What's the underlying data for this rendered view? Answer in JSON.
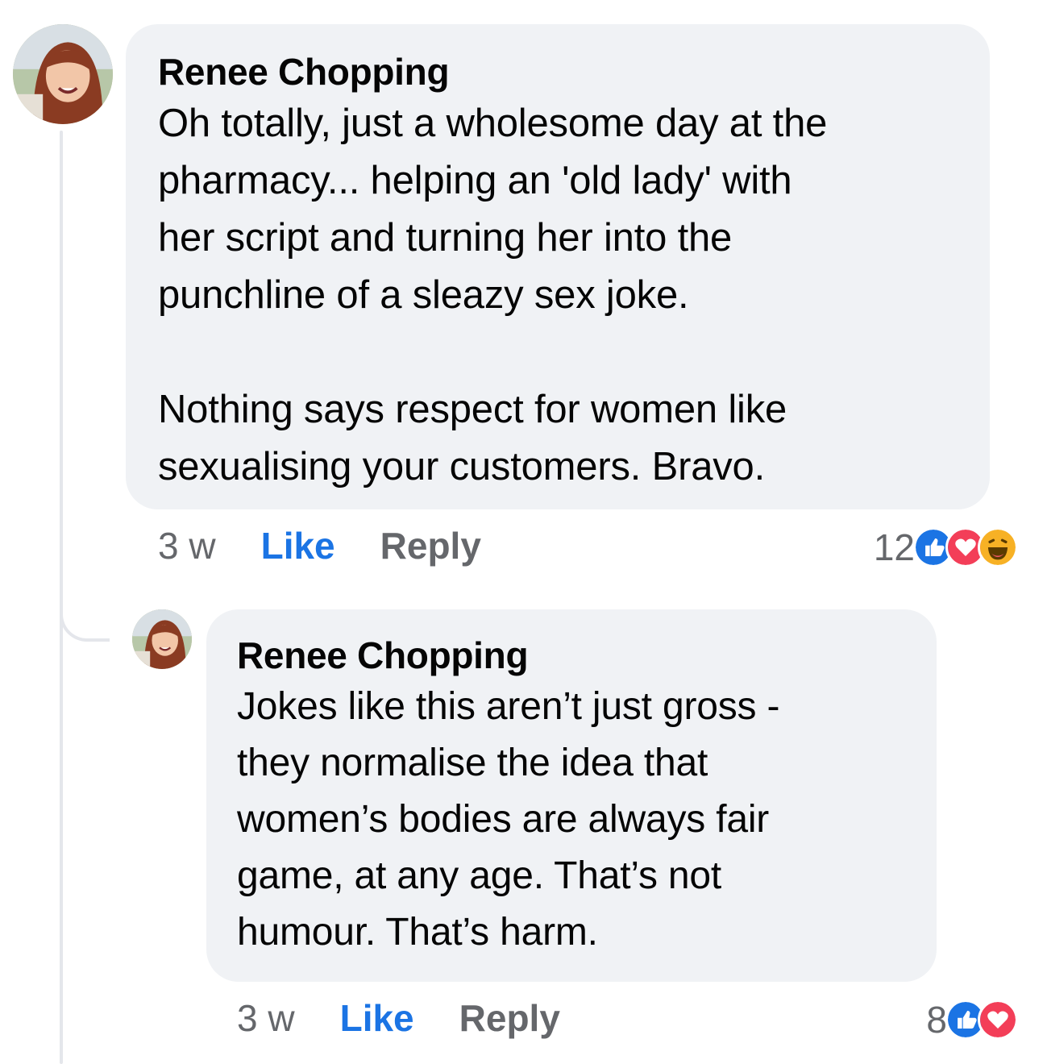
{
  "comments": [
    {
      "author": "Renee Chopping",
      "text": "Oh totally, just a wholesome day at the\npharmacy... helping an 'old lady' with\nher script and turning her into the\npunchline of a sleazy sex joke.\n\nNothing says respect for women like\nsexualising your customers. Bravo.",
      "time": "3 w",
      "like_label": "Like",
      "reply_label": "Reply",
      "reaction_count": "12",
      "reactions": [
        "like-reaction-icon",
        "love-reaction-icon",
        "haha-reaction-icon"
      ]
    },
    {
      "author": "Renee Chopping",
      "text": "Jokes like this aren’t just gross -\nthey normalise the idea that\nwomen’s bodies are always fair\ngame, at any age. That’s not\nhumour. That’s harm.",
      "time": "3 w",
      "like_label": "Like",
      "reply_label": "Reply",
      "reaction_count": "8",
      "reactions": [
        "like-reaction-icon",
        "love-reaction-icon"
      ]
    }
  ],
  "colors": {
    "bubble": "#f0f2f5",
    "like_blue": "#1b74e4",
    "love_red": "#f33e58",
    "haha_yellow": "#f7b125",
    "meta_gray": "#65676b"
  }
}
